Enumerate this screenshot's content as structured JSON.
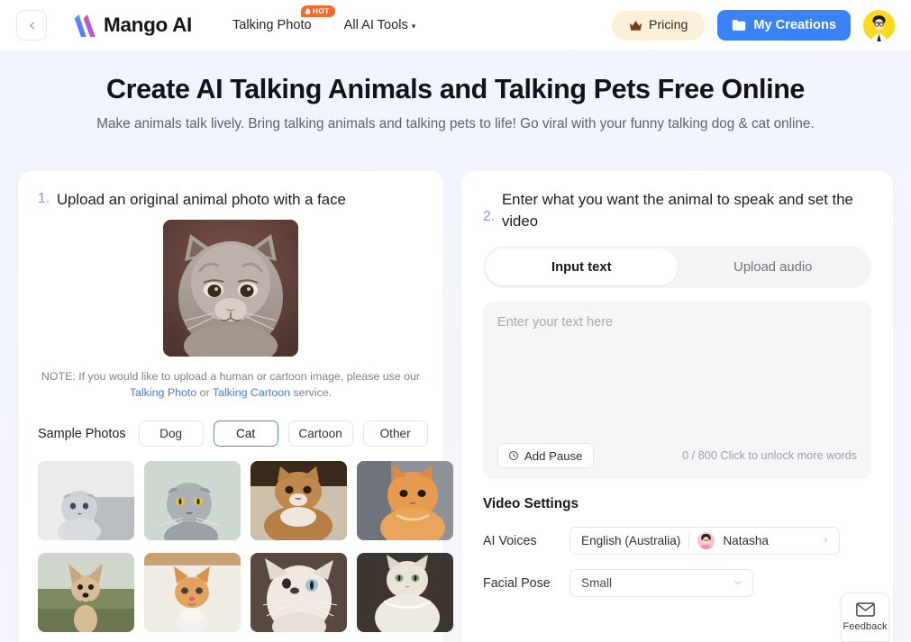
{
  "header": {
    "back_icon": "chevron-left-icon",
    "logo_text": "Mango AI",
    "nav": [
      {
        "label": "Talking Photo",
        "badge": "HOT",
        "badge_icon": "flame-icon",
        "has_caret": false
      },
      {
        "label": "All AI Tools",
        "badge": "",
        "badge_icon": "",
        "has_caret": true
      }
    ],
    "pricing_label": "Pricing",
    "pricing_icon": "crown-icon",
    "creations_label": "My Creations",
    "creations_icon": "folder-icon",
    "avatar_icon": "user-avatar",
    "colors": {
      "primary_blue": "#3b82f6",
      "pricing_bg": "#fdf0d8",
      "hot_orange": "#f96a2a",
      "avatar_yellow": "#ffd91c"
    }
  },
  "hero": {
    "title": "Create AI Talking Animals and Talking Pets Free Online",
    "subtitle": "Make animals talk lively. Bring talking animals and talking pets to life! Go viral with your funny talking dog & cat online."
  },
  "left_panel": {
    "step_number": "1.",
    "step_title": "Upload an original animal photo with a face",
    "preview_alt": "cat-preview-image",
    "note_prefix": "NOTE: If you would like to upload a human or cartoon image, please use our ",
    "note_link1": "Talking Photo",
    "note_mid": " or ",
    "note_link2": "Talking Cartoon",
    "note_suffix": " service.",
    "samples_label": "Sample Photos",
    "chips": [
      {
        "label": "Dog",
        "active": false
      },
      {
        "label": "Cat",
        "active": true
      },
      {
        "label": "Cartoon",
        "active": false
      },
      {
        "label": "Other",
        "active": false
      }
    ],
    "thumbnails": [
      {
        "name": "scottish-fold-kitten-grey"
      },
      {
        "name": "scottish-fold-cat-grey"
      },
      {
        "name": "british-shorthair-golden"
      },
      {
        "name": "persian-cat-orange"
      },
      {
        "name": "chihuahua-dog-tan"
      },
      {
        "name": "ginger-kitten-looking-up"
      },
      {
        "name": "white-fluffy-cat-looking-up"
      },
      {
        "name": "white-siberian-cat"
      }
    ]
  },
  "right_panel": {
    "step_number": "2.",
    "step_title": "Enter what you want the animal to speak and set the video",
    "tabs": [
      {
        "label": "Input text",
        "active": true
      },
      {
        "label": "Upload audio",
        "active": false
      }
    ],
    "textarea_placeholder": "Enter your text here",
    "textarea_value": "",
    "add_pause_label": "Add Pause",
    "add_pause_icon": "clock-icon",
    "counter": "0 / 800 Click to unlock more words",
    "video_settings_title": "Video Settings",
    "ai_voices_label": "AI Voices",
    "ai_voices_language": "English (Australia)",
    "ai_voices_name": "Natasha",
    "ai_voices_chevron": "chevron-right-icon",
    "facial_pose_label": "Facial Pose",
    "facial_pose_value": "Small",
    "facial_pose_chevron": "chevron-down-icon"
  },
  "feedback": {
    "label": "Feedback",
    "icon": "envelope-icon"
  }
}
